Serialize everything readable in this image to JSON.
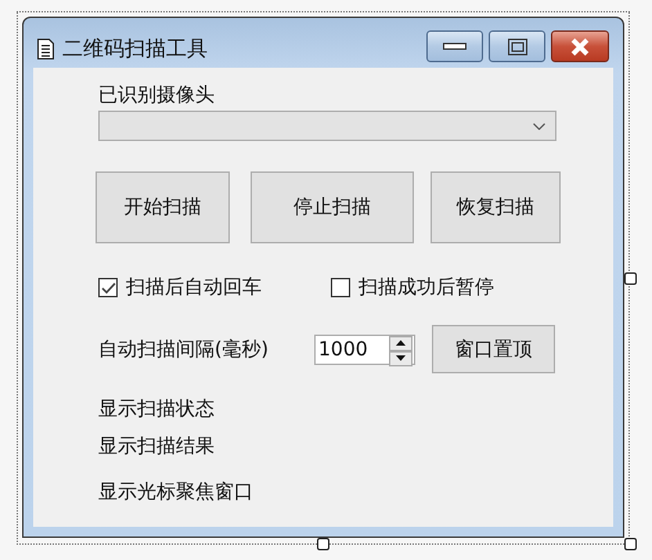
{
  "window": {
    "title": "二维码扫描工具"
  },
  "camera": {
    "label": "已识别摄像头"
  },
  "buttons": [
    "开始扫描",
    "停止扫描",
    "恢复扫描"
  ],
  "checkboxes": [
    {
      "label": "扫描后自动回车",
      "checked": true
    },
    {
      "label": "扫描成功后暂停",
      "checked": false
    }
  ],
  "interval": {
    "label": "自动扫描间隔(毫秒)",
    "value": "1000"
  },
  "topmost_button": "窗口置顶",
  "status_labels": [
    "显示扫描状态",
    "显示扫描结果",
    "显示光标聚焦窗口"
  ]
}
